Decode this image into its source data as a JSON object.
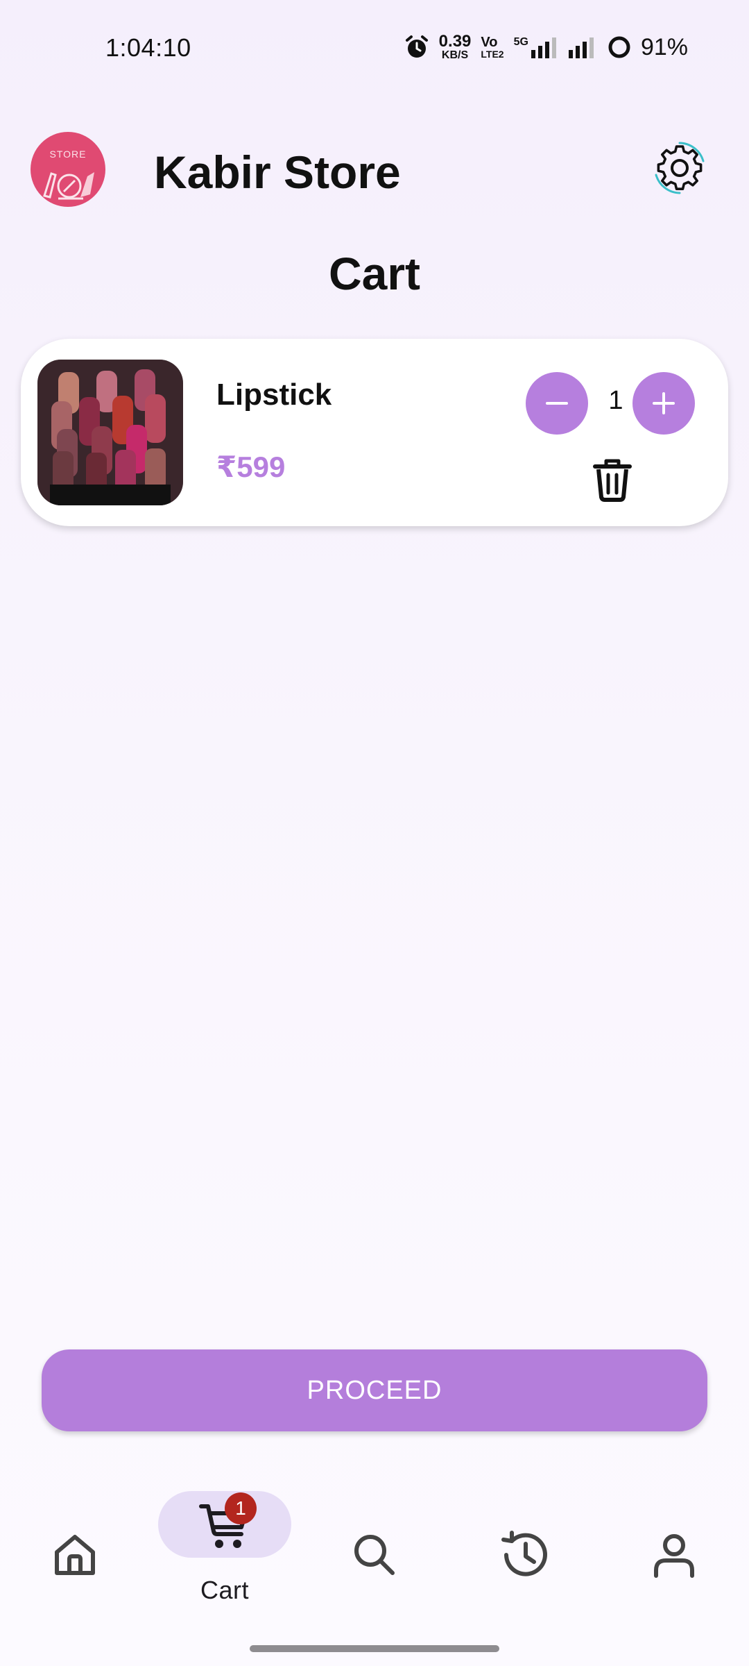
{
  "status_bar": {
    "time": "1:04:10",
    "net_speed_value": "0.39",
    "net_speed_unit": "KB/S",
    "volte_top": "Vo",
    "volte_bottom": "LTE2",
    "network": "5G",
    "battery": "91%",
    "icons": [
      "alarm-icon",
      "signal-5g-icon",
      "signal-icon",
      "battery-icon"
    ]
  },
  "header": {
    "logo_text": "STORE",
    "store_name": "Kabir Store",
    "settings_icon": "gear-icon"
  },
  "page": {
    "title": "Cart"
  },
  "cart": {
    "items": [
      {
        "name": "Lipstick",
        "price": "₹599",
        "quantity": "1",
        "image": "lipstick-photo"
      }
    ]
  },
  "actions": {
    "proceed_label": "PROCEED"
  },
  "bottom_nav": {
    "items": [
      {
        "icon": "home-icon",
        "label": ""
      },
      {
        "icon": "cart-icon",
        "label": "Cart",
        "badge": "1",
        "selected": true
      },
      {
        "icon": "search-icon",
        "label": ""
      },
      {
        "icon": "history-icon",
        "label": ""
      },
      {
        "icon": "profile-icon",
        "label": ""
      }
    ]
  },
  "colors": {
    "accent": "#b67fde",
    "nav_pill": "#e6ddf6",
    "badge": "#b3261e",
    "logo": "#e04a72"
  }
}
